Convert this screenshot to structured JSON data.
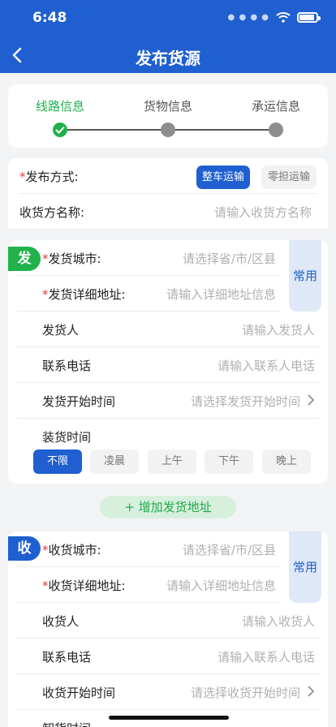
{
  "status": {
    "time": "6:48"
  },
  "header": {
    "title": "发布货源"
  },
  "steps": [
    {
      "label": "线路信息"
    },
    {
      "label": "货物信息"
    },
    {
      "label": "承运信息"
    }
  ],
  "publish": {
    "method_label": "发布方式:",
    "options": [
      "整车运输",
      "零担运输"
    ],
    "receiver_name_label": "收货方名称:",
    "receiver_name_placeholder": "请输入收货方名称"
  },
  "ship": {
    "badge": "发",
    "common_label": "常用",
    "city_label": "发货城市:",
    "city_placeholder": "请选择省/市/区县",
    "address_label": "发货详细地址:",
    "address_placeholder": "请输入详细地址信息",
    "contact_label": "发货人",
    "contact_placeholder": "请输入发货人",
    "phone_label": "联系电话",
    "phone_placeholder": "请输入联系人电话",
    "start_time_label": "发货开始时间",
    "start_time_placeholder": "请选择发货开始时间",
    "loading_label": "装货时间",
    "time_options": [
      "不限",
      "凌晨",
      "上午",
      "下午",
      "晚上"
    ]
  },
  "add_address": "+ 增加发货地址",
  "recv": {
    "badge": "收",
    "common_label": "常用",
    "city_label": "收货城市:",
    "city_placeholder": "请选择省/市/区县",
    "address_label": "收货详细地址:",
    "address_placeholder": "请输入详细地址信息",
    "contact_label": "收货人",
    "contact_placeholder": "请输入收货人",
    "phone_label": "联系电话",
    "phone_placeholder": "请输入联系人电话",
    "start_time_label": "收货开始时间",
    "start_time_placeholder": "请选择收货开始时间",
    "unloading_label": "卸货时间"
  },
  "colors": {
    "primary": "#1f5fd0",
    "success": "#21b24b",
    "required": "#e23b3b"
  }
}
